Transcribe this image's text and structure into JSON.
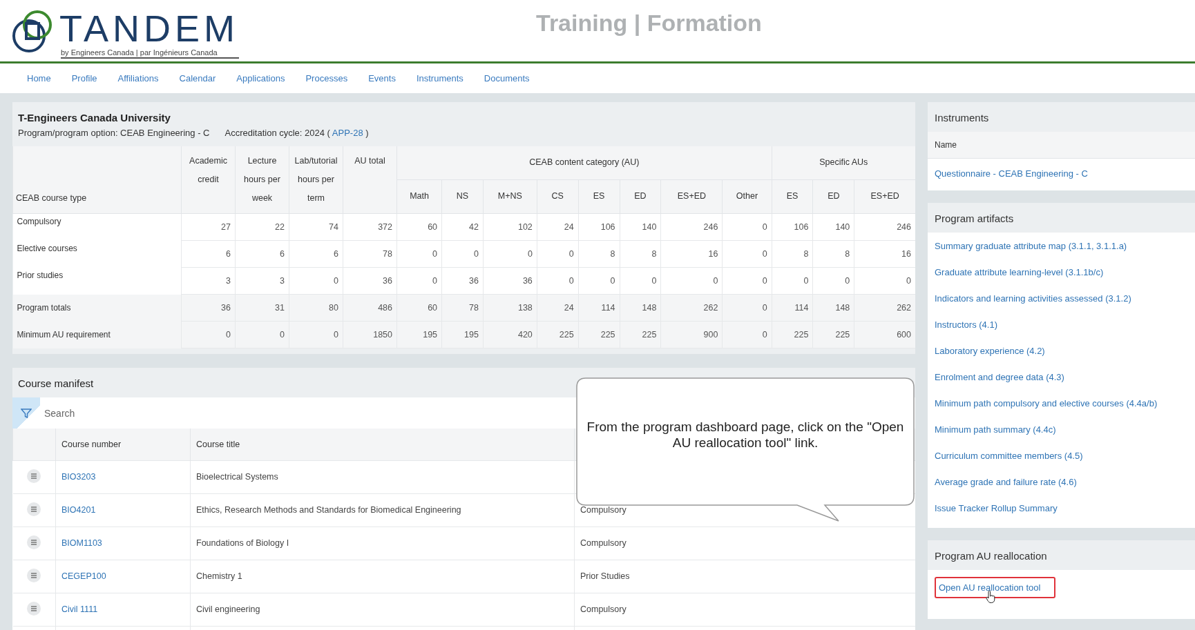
{
  "header": {
    "logo_text": "TANDEM",
    "tagline": "by Engineers Canada | par Ingénieurs Canada",
    "title": "Training | Formation"
  },
  "nav": [
    {
      "label": "Home"
    },
    {
      "label": "Profile"
    },
    {
      "label": "Affiliations"
    },
    {
      "label": "Calendar"
    },
    {
      "label": "Applications"
    },
    {
      "label": "Processes"
    },
    {
      "label": "Events"
    },
    {
      "label": "Instruments"
    },
    {
      "label": "Documents"
    }
  ],
  "program_summary": {
    "institution": "T-Engineers Canada University",
    "program_option": "Program/program option: CEAB Engineering - C",
    "cycle_prefix": "Accreditation cycle: 2024 (",
    "cycle_link": "APP-28",
    "cycle_suffix": ")"
  },
  "au_table": {
    "corner": "CEAB course type",
    "columns": [
      "Academic credit",
      "Lecture hours per week",
      "Lab/tutorial hours per term",
      "AU total"
    ],
    "groups": [
      {
        "label": "CEAB content category (AU)",
        "columns": [
          "Math",
          "NS",
          "M+NS",
          "CS",
          "ES",
          "ED",
          "ES+ED",
          "Other"
        ]
      },
      {
        "label": "Specific AUs",
        "columns": [
          "ES",
          "ED",
          "ES+ED"
        ]
      }
    ],
    "rows": [
      {
        "label": "Compulsory",
        "kind": "course",
        "values": [
          "27",
          "22",
          "74",
          "372",
          "60",
          "42",
          "102",
          "24",
          "106",
          "140",
          "246",
          "0",
          "106",
          "140",
          "246"
        ]
      },
      {
        "label": "Elective courses",
        "kind": "course",
        "values": [
          "6",
          "6",
          "6",
          "78",
          "0",
          "0",
          "0",
          "0",
          "8",
          "8",
          "16",
          "0",
          "8",
          "8",
          "16"
        ]
      },
      {
        "label": "Prior studies",
        "kind": "course",
        "values": [
          "3",
          "3",
          "0",
          "36",
          "0",
          "36",
          "36",
          "0",
          "0",
          "0",
          "0",
          "0",
          "0",
          "0",
          "0"
        ]
      },
      {
        "label": "Program totals",
        "kind": "summary",
        "values": [
          "36",
          "31",
          "80",
          "486",
          "60",
          "78",
          "138",
          "24",
          "114",
          "148",
          "262",
          "0",
          "114",
          "148",
          "262"
        ]
      },
      {
        "label": "Minimum AU requirement",
        "kind": "summary",
        "values": [
          "0",
          "0",
          "0",
          "1850",
          "195",
          "195",
          "420",
          "225",
          "225",
          "225",
          "900",
          "0",
          "225",
          "225",
          "600"
        ]
      }
    ]
  },
  "course_manifest": {
    "title": "Course manifest",
    "search": {
      "placeholder": "Search"
    },
    "columns": [
      "Course number",
      "Course title"
    ],
    "rows": [
      {
        "number": "BIO3203",
        "title": "Bioelectrical Systems"
      },
      {
        "number": "BIO4201",
        "title": "Ethics, Research Methods and Standards for Biomedical Engineering",
        "type": "Compulsory"
      },
      {
        "number": "BIOM1103",
        "title": "Foundations of Biology I",
        "type": "Compulsory"
      },
      {
        "number": "CEGEP100",
        "title": "Chemistry 1",
        "type": "Prior Studies"
      },
      {
        "number": "Civil 1111",
        "title": "Civil engineering",
        "type": "Compulsory"
      }
    ]
  },
  "callout": {
    "text": "From the program dashboard page, click on the \"Open AU reallocation tool\" link."
  },
  "sidebar": {
    "instruments": {
      "title": "Instruments",
      "column": "Name",
      "items": [
        "Questionnaire - CEAB Engineering - C"
      ]
    },
    "artifacts": {
      "title": "Program artifacts",
      "links": [
        "Summary graduate attribute map (3.1.1, 3.1.1.a)",
        "Graduate attribute learning-level (3.1.1b/c)",
        "Indicators and learning activities assessed (3.1.2)",
        "Instructors (4.1)",
        "Laboratory experience (4.2)",
        "Enrolment and degree data (4.3)",
        "Minimum path compulsory and elective courses (4.4a/b)",
        "Minimum path summary (4.4c)",
        "Curriculum committee members (4.5)",
        "Average grade and failure rate (4.6)",
        "Issue Tracker Rollup Summary"
      ]
    },
    "reallocation": {
      "title": "Program AU reallocation",
      "link": "Open AU reallocation tool"
    }
  }
}
